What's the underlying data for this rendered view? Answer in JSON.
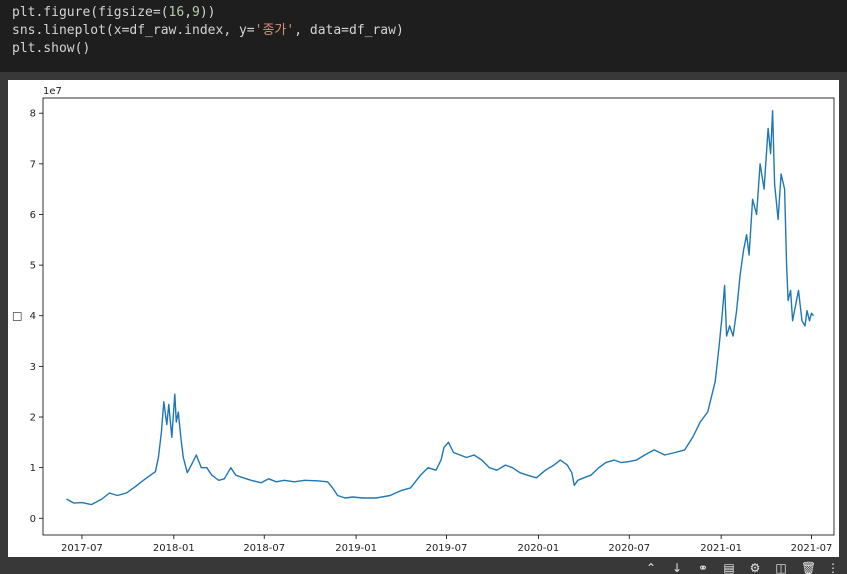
{
  "code_cell": {
    "lines": [
      [
        {
          "t": "plt.figure(figsize=(",
          "c": ""
        },
        {
          "t": "16",
          "c": "num"
        },
        {
          "t": ",",
          "c": ""
        },
        {
          "t": "9",
          "c": "num"
        },
        {
          "t": "))",
          "c": ""
        }
      ],
      [
        {
          "t": "sns.lineplot(x=df_raw.index, y=",
          "c": ""
        },
        {
          "t": "'종가'",
          "c": "str"
        },
        {
          "t": ", data=df_raw)",
          "c": ""
        }
      ],
      [
        {
          "t": "plt.show()",
          "c": ""
        }
      ]
    ]
  },
  "toolbar": {
    "icons": [
      "move-up-icon",
      "move-down-icon",
      "link-icon",
      "comment-icon",
      "settings-icon",
      "mirror-icon",
      "delete-icon",
      "more-icon"
    ]
  },
  "colors": {
    "line": "#1f77b4",
    "code_bg": "#1e1e1e",
    "page_bg": "#383838"
  },
  "chart_data": {
    "type": "line",
    "title": "",
    "xlabel": "",
    "ylabel": "□",
    "scale_label": "1e7",
    "x_ticks": [
      "2017-07",
      "2018-01",
      "2018-07",
      "2019-01",
      "2019-07",
      "2020-01",
      "2020-07",
      "2021-01",
      "2021-07"
    ],
    "y_ticks": [
      "0",
      "1",
      "2",
      "3",
      "4",
      "5",
      "6",
      "7",
      "8"
    ],
    "xlim": [
      "2017-04-14",
      "2021-08-15"
    ],
    "ylim": [
      -0.33,
      8.3
    ],
    "grid": false,
    "series": [
      {
        "name": "",
        "color": "#1f77b4",
        "x": [
          "2017-05-31",
          "2017-06-15",
          "2017-07-01",
          "2017-07-20",
          "2017-08-10",
          "2017-08-25",
          "2017-09-10",
          "2017-09-28",
          "2017-10-15",
          "2017-11-01",
          "2017-11-15",
          "2017-11-25",
          "2017-12-01",
          "2017-12-07",
          "2017-12-12",
          "2017-12-18",
          "2017-12-22",
          "2017-12-28",
          "2018-01-03",
          "2018-01-06",
          "2018-01-10",
          "2018-01-15",
          "2018-01-20",
          "2018-01-28",
          "2018-02-05",
          "2018-02-15",
          "2018-02-25",
          "2018-03-08",
          "2018-03-18",
          "2018-04-01",
          "2018-04-12",
          "2018-04-25",
          "2018-05-05",
          "2018-05-20",
          "2018-06-05",
          "2018-06-25",
          "2018-07-10",
          "2018-07-25",
          "2018-08-10",
          "2018-08-30",
          "2018-09-20",
          "2018-10-15",
          "2018-11-05",
          "2018-11-15",
          "2018-11-25",
          "2018-12-10",
          "2018-12-25",
          "2019-01-15",
          "2019-02-10",
          "2019-03-10",
          "2019-04-02",
          "2019-04-20",
          "2019-05-10",
          "2019-05-25",
          "2019-06-10",
          "2019-06-20",
          "2019-06-26",
          "2019-07-05",
          "2019-07-15",
          "2019-07-28",
          "2019-08-10",
          "2019-08-25",
          "2019-09-10",
          "2019-09-25",
          "2019-10-10",
          "2019-10-27",
          "2019-11-10",
          "2019-11-25",
          "2019-12-10",
          "2019-12-28",
          "2020-01-15",
          "2020-02-01",
          "2020-02-14",
          "2020-02-28",
          "2020-03-08",
          "2020-03-13",
          "2020-03-20",
          "2020-04-01",
          "2020-04-15",
          "2020-05-01",
          "2020-05-15",
          "2020-06-01",
          "2020-06-15",
          "2020-07-01",
          "2020-07-15",
          "2020-08-01",
          "2020-08-20",
          "2020-09-10",
          "2020-10-01",
          "2020-10-20",
          "2020-11-05",
          "2020-11-20",
          "2020-12-05",
          "2020-12-20",
          "2020-12-28",
          "2021-01-03",
          "2021-01-08",
          "2021-01-12",
          "2021-01-18",
          "2021-01-25",
          "2021-02-01",
          "2021-02-08",
          "2021-02-15",
          "2021-02-21",
          "2021-02-26",
          "2021-03-05",
          "2021-03-13",
          "2021-03-20",
          "2021-03-28",
          "2021-04-05",
          "2021-04-10",
          "2021-04-14",
          "2021-04-18",
          "2021-04-25",
          "2021-05-01",
          "2021-05-08",
          "2021-05-12",
          "2021-05-15",
          "2021-05-20",
          "2021-05-24",
          "2021-05-30",
          "2021-06-05",
          "2021-06-12",
          "2021-06-18",
          "2021-06-22",
          "2021-06-27",
          "2021-07-01",
          "2021-07-05"
        ],
        "values": [
          0.38,
          0.3,
          0.31,
          0.27,
          0.38,
          0.5,
          0.45,
          0.5,
          0.62,
          0.75,
          0.85,
          0.92,
          1.2,
          1.7,
          2.3,
          1.85,
          2.25,
          1.6,
          2.45,
          1.9,
          2.1,
          1.6,
          1.2,
          0.9,
          1.05,
          1.25,
          1.0,
          1.0,
          0.85,
          0.75,
          0.78,
          1.0,
          0.85,
          0.8,
          0.75,
          0.7,
          0.78,
          0.72,
          0.75,
          0.72,
          0.75,
          0.74,
          0.72,
          0.6,
          0.45,
          0.4,
          0.42,
          0.4,
          0.4,
          0.45,
          0.55,
          0.6,
          0.85,
          1.0,
          0.95,
          1.15,
          1.4,
          1.5,
          1.3,
          1.25,
          1.2,
          1.25,
          1.15,
          1.0,
          0.95,
          1.05,
          1.0,
          0.9,
          0.85,
          0.8,
          0.95,
          1.05,
          1.15,
          1.05,
          0.9,
          0.65,
          0.75,
          0.8,
          0.85,
          1.0,
          1.1,
          1.15,
          1.1,
          1.12,
          1.15,
          1.25,
          1.35,
          1.25,
          1.3,
          1.35,
          1.6,
          1.9,
          2.1,
          2.7,
          3.4,
          4.0,
          4.6,
          3.6,
          3.8,
          3.6,
          4.1,
          4.8,
          5.3,
          5.6,
          5.2,
          6.3,
          6.0,
          7.0,
          6.5,
          7.7,
          7.2,
          8.05,
          6.6,
          5.9,
          6.8,
          6.5,
          5.0,
          4.3,
          4.5,
          3.9,
          4.2,
          4.5,
          3.9,
          3.8,
          4.1,
          3.9,
          4.05,
          4.0
        ]
      }
    ]
  }
}
